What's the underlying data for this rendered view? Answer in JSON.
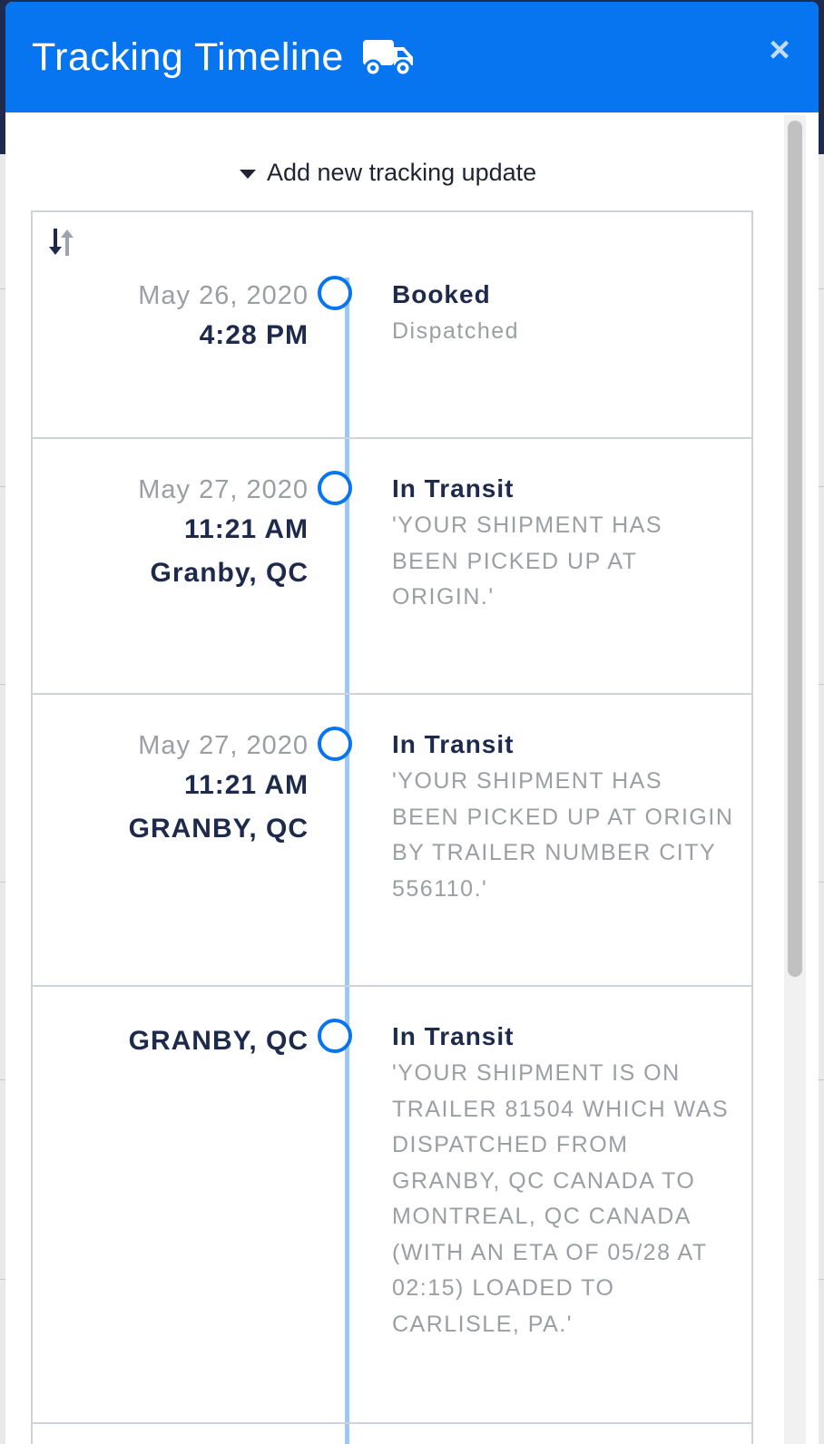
{
  "modal": {
    "title": "Tracking Timeline",
    "close_label": "×",
    "add_update_label": "Add new tracking update"
  },
  "timeline": {
    "entries": [
      {
        "date": "May 26, 2020",
        "time": "4:28 PM",
        "location": "",
        "status": "Booked",
        "detail": "Dispatched"
      },
      {
        "date": "May 27, 2020",
        "time": "11:21 AM",
        "location": "Granby, QC",
        "status": "In Transit",
        "detail": "'YOUR SHIPMENT HAS BEEN PICKED UP AT ORIGIN.'"
      },
      {
        "date": "May 27, 2020",
        "time": "11:21 AM",
        "location": "GRANBY, QC",
        "status": "In Transit",
        "detail": "'YOUR SHIPMENT HAS BEEN PICKED UP AT ORIGIN BY TRAILER NUMBER CITY 556110.'"
      },
      {
        "date": "",
        "time": "",
        "location": "GRANBY, QC",
        "status": "In Transit",
        "detail": "'YOUR SHIPMENT IS ON TRAILER 81504 WHICH WAS DISPATCHED FROM GRANBY, QC CANADA TO MONTREAL, QC CANADA (WITH AN ETA OF 05/28 AT 02:15) LOADED TO CARLISLE, PA.'"
      }
    ]
  },
  "icons": {
    "truck": "truck-icon",
    "close": "close-icon",
    "caret": "caret-down-icon",
    "sort": "sort-icon"
  },
  "colors": {
    "header": "#0875f0",
    "timeline_line": "#9ec7f5",
    "dot": "#0875f0",
    "strong_text": "#1e2a4b",
    "muted_text": "#9b9ea3"
  }
}
